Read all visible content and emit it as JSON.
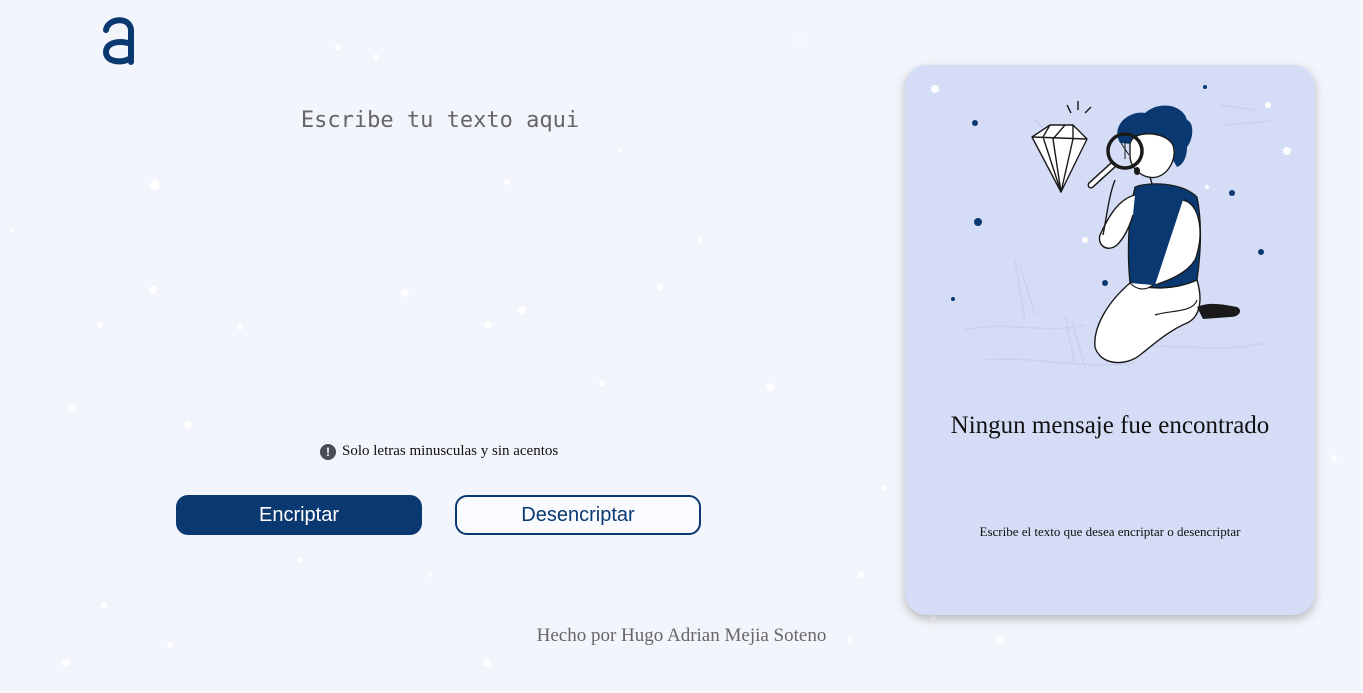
{
  "logo": {
    "icon": "alura-a-logo",
    "color": "#0a3871"
  },
  "editor": {
    "placeholder": "Escribe tu texto aqui",
    "value": ""
  },
  "hint": {
    "icon": "exclamation-circle-icon",
    "text": "Solo letras minusculas y sin acentos"
  },
  "actions": {
    "encrypt_label": "Encriptar",
    "decrypt_label": "Desencriptar"
  },
  "result_panel": {
    "illustration": "person-with-magnifying-glass-diamond",
    "title": "Ningun mensaje fue encontrado",
    "subtitle": "Escribe el texto que desea encriptar o desencriptar"
  },
  "footer": {
    "text": "Hecho por Hugo Adrian Mejia Soteno"
  },
  "colors": {
    "background": "#f3f5fc",
    "primary": "#0a3871",
    "card": "#d5dcf5"
  }
}
